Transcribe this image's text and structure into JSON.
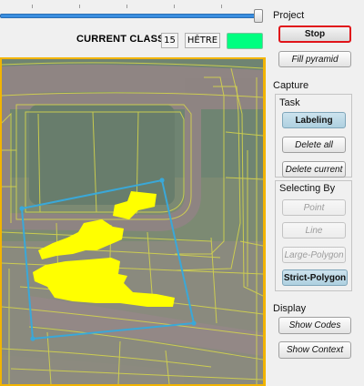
{
  "toolbar": {
    "current_class_label": "CURRENT CLASS:",
    "class_number": "15",
    "class_name": "HÊTRE",
    "class_color": "#00ff80"
  },
  "slider": {
    "value_fraction": 0.97
  },
  "panel": {
    "project_title": "Project",
    "stop_label": "Stop",
    "fill_pyramid_label": "Fill pyramid",
    "capture_title": "Capture",
    "task_title": "Task",
    "labeling_label": "Labeling",
    "delete_all_label": "Delete all",
    "delete_current_label": "Delete current",
    "selecting_by_title": "Selecting By",
    "point_label": "Point",
    "line_label": "Line",
    "large_polygon_label": "Large-Polygon",
    "strict_polygon_label": "Strict-Polygon",
    "display_title": "Display",
    "show_codes_label": "Show Codes",
    "show_context_label": "Show Context"
  },
  "colors": {
    "selection_highlight": "#ffff00",
    "polygon_outline": "#3aa8d8",
    "segment_lines": "#d8d84a",
    "map_border": "#f2b400"
  }
}
